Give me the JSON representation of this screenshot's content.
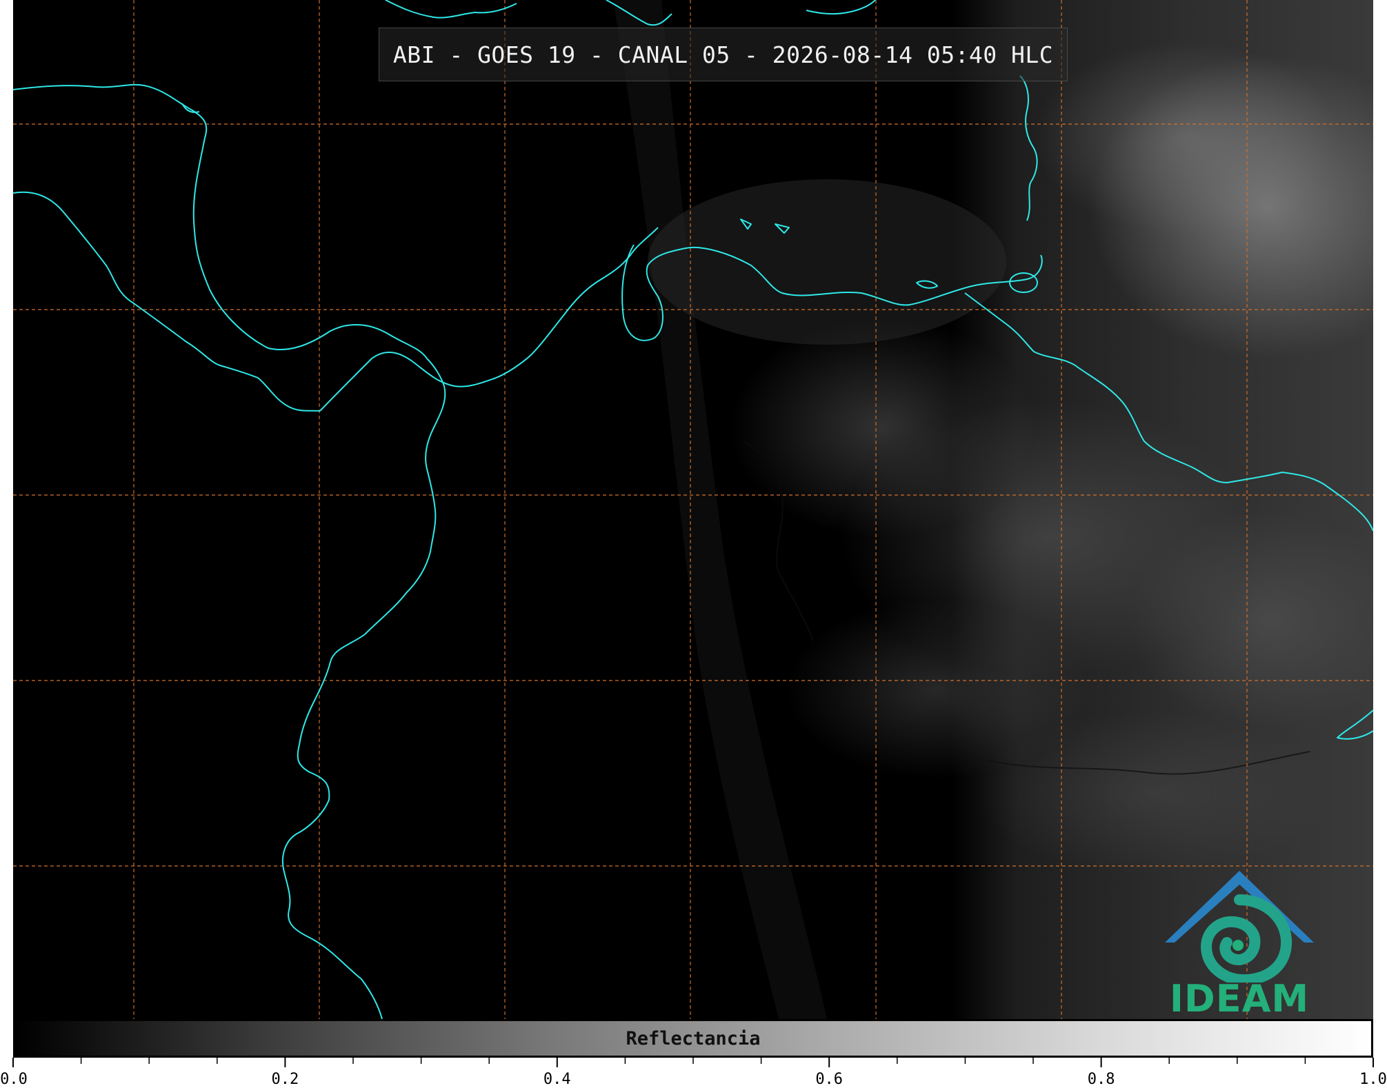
{
  "title": "ABI - GOES 19 - CANAL 05 - 2026-08-14 05:40 HLC",
  "logo": {
    "text": "IDEAM",
    "color_blue": "#2a7fbf",
    "color_green": "#23b07a"
  },
  "colorbar": {
    "label": "Reflectancia",
    "min": 0.0,
    "max": 1.0,
    "tick_labels": [
      "0.0",
      "0.2",
      "0.4",
      "0.6",
      "0.8",
      "1.0"
    ],
    "major_step": 0.2,
    "minor_step": 0.05,
    "colormap": "gray"
  },
  "map": {
    "coastline_color": "#2fe8e8",
    "gridline_color": "#d2702a",
    "gridline_style": "dashed",
    "background": "#000000"
  }
}
